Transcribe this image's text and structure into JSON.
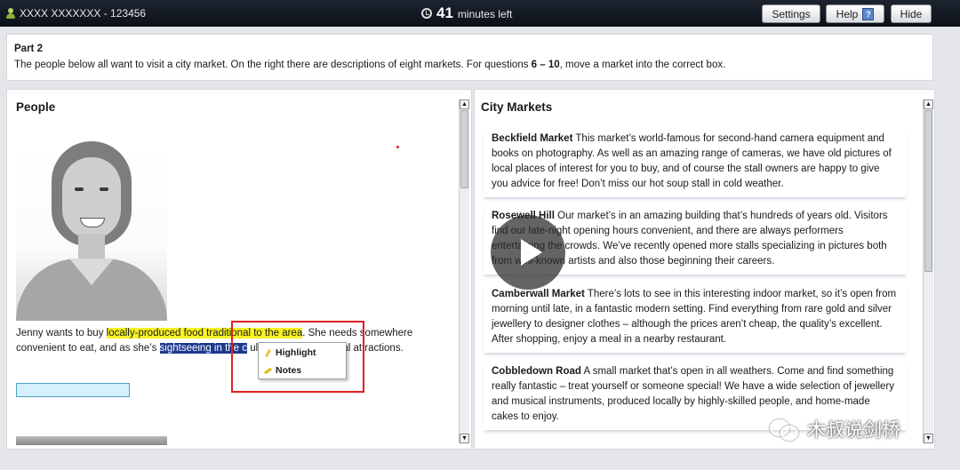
{
  "topbar": {
    "candidate": "XXXX XXXXXXX - 123456",
    "timer_value": "41",
    "timer_label": "minutes left",
    "settings_label": "Settings",
    "help_label": "Help",
    "help_icon_glyph": "?",
    "hide_label": "Hide"
  },
  "instruction": {
    "part": "Part 2",
    "text_before": "The people below all want to visit a city market. On the right there are descriptions of eight markets. For questions ",
    "range": "6 – 10",
    "text_after": ", move a market into the correct box."
  },
  "people": {
    "heading": "People",
    "text_1": "Jenny wants to buy ",
    "highlighted": "locally-produced food traditional to the area",
    "text_2": ". She needs somewhere convenient to eat, and as she’s ",
    "selected": "sightseeing in the c",
    "text_3": "         uldn’t be far from local attractions."
  },
  "context_menu": {
    "highlight_label": "Highlight",
    "notes_label": "Notes"
  },
  "markets": {
    "heading": "City Markets",
    "items": [
      {
        "name": "Beckfield Market",
        "text": " This market’s world-famous for second-hand camera equipment and books on photography. As well as an amazing range of cameras, we have old pictures of local places of interest for you to buy, and of course the stall owners are happy to give you advice for free! Don’t miss our hot soup stall in cold weather."
      },
      {
        "name": "Rosewell Hill",
        "text": " Our market’s in an amazing building that’s hundreds of years old. Visitors find our late-night opening hours convenient, and there are always performers entertaining the crowds. We’ve recently opened more stalls specializing in pictures both from well-known artists and also those beginning their careers."
      },
      {
        "name": "Camberwall Market",
        "text": " There’s lots to see in this interesting indoor market, so it’s open from morning until late, in a fantastic modern setting. Find everything from rare gold and silver jewellery to designer clothes – although the prices aren’t cheap, the quality’s excellent. After shopping, enjoy a meal in a nearby restaurant."
      },
      {
        "name": "Cobbledown Road",
        "text": " A small market that’s open in all weathers. Come and find something really fantastic – treat yourself or someone special! We have a wide selection of jewellery and musical instruments, produced locally by highly-skilled people, and home-made cakes to enjoy."
      }
    ]
  },
  "scrollbar_arrows": {
    "up": "▲",
    "down": "▼"
  },
  "watermark": "木叔说剑桥",
  "icons": [
    "person-icon",
    "clock-icon",
    "help-icon",
    "pen-icon",
    "note-icon",
    "play-icon",
    "wechat-icon"
  ]
}
